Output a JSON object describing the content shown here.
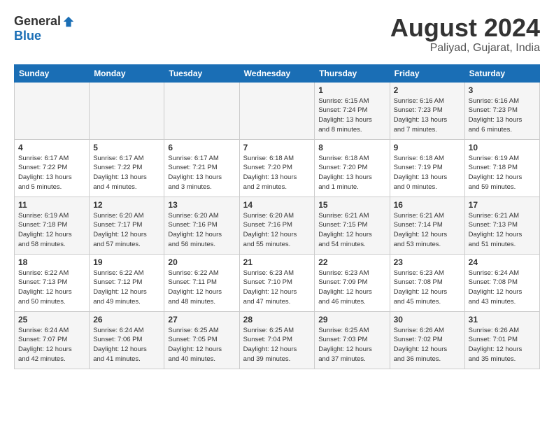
{
  "header": {
    "logo": {
      "general": "General",
      "blue": "Blue"
    },
    "title": "August 2024",
    "location": "Paliyad, Gujarat, India"
  },
  "days_of_week": [
    "Sunday",
    "Monday",
    "Tuesday",
    "Wednesday",
    "Thursday",
    "Friday",
    "Saturday"
  ],
  "weeks": [
    [
      {
        "num": "",
        "info": ""
      },
      {
        "num": "",
        "info": ""
      },
      {
        "num": "",
        "info": ""
      },
      {
        "num": "",
        "info": ""
      },
      {
        "num": "1",
        "info": "Sunrise: 6:15 AM\nSunset: 7:24 PM\nDaylight: 13 hours\nand 8 minutes."
      },
      {
        "num": "2",
        "info": "Sunrise: 6:16 AM\nSunset: 7:23 PM\nDaylight: 13 hours\nand 7 minutes."
      },
      {
        "num": "3",
        "info": "Sunrise: 6:16 AM\nSunset: 7:23 PM\nDaylight: 13 hours\nand 6 minutes."
      }
    ],
    [
      {
        "num": "4",
        "info": "Sunrise: 6:17 AM\nSunset: 7:22 PM\nDaylight: 13 hours\nand 5 minutes."
      },
      {
        "num": "5",
        "info": "Sunrise: 6:17 AM\nSunset: 7:22 PM\nDaylight: 13 hours\nand 4 minutes."
      },
      {
        "num": "6",
        "info": "Sunrise: 6:17 AM\nSunset: 7:21 PM\nDaylight: 13 hours\nand 3 minutes."
      },
      {
        "num": "7",
        "info": "Sunrise: 6:18 AM\nSunset: 7:20 PM\nDaylight: 13 hours\nand 2 minutes."
      },
      {
        "num": "8",
        "info": "Sunrise: 6:18 AM\nSunset: 7:20 PM\nDaylight: 13 hours\nand 1 minute."
      },
      {
        "num": "9",
        "info": "Sunrise: 6:18 AM\nSunset: 7:19 PM\nDaylight: 13 hours\nand 0 minutes."
      },
      {
        "num": "10",
        "info": "Sunrise: 6:19 AM\nSunset: 7:18 PM\nDaylight: 12 hours\nand 59 minutes."
      }
    ],
    [
      {
        "num": "11",
        "info": "Sunrise: 6:19 AM\nSunset: 7:18 PM\nDaylight: 12 hours\nand 58 minutes."
      },
      {
        "num": "12",
        "info": "Sunrise: 6:20 AM\nSunset: 7:17 PM\nDaylight: 12 hours\nand 57 minutes."
      },
      {
        "num": "13",
        "info": "Sunrise: 6:20 AM\nSunset: 7:16 PM\nDaylight: 12 hours\nand 56 minutes."
      },
      {
        "num": "14",
        "info": "Sunrise: 6:20 AM\nSunset: 7:16 PM\nDaylight: 12 hours\nand 55 minutes."
      },
      {
        "num": "15",
        "info": "Sunrise: 6:21 AM\nSunset: 7:15 PM\nDaylight: 12 hours\nand 54 minutes."
      },
      {
        "num": "16",
        "info": "Sunrise: 6:21 AM\nSunset: 7:14 PM\nDaylight: 12 hours\nand 53 minutes."
      },
      {
        "num": "17",
        "info": "Sunrise: 6:21 AM\nSunset: 7:13 PM\nDaylight: 12 hours\nand 51 minutes."
      }
    ],
    [
      {
        "num": "18",
        "info": "Sunrise: 6:22 AM\nSunset: 7:13 PM\nDaylight: 12 hours\nand 50 minutes."
      },
      {
        "num": "19",
        "info": "Sunrise: 6:22 AM\nSunset: 7:12 PM\nDaylight: 12 hours\nand 49 minutes."
      },
      {
        "num": "20",
        "info": "Sunrise: 6:22 AM\nSunset: 7:11 PM\nDaylight: 12 hours\nand 48 minutes."
      },
      {
        "num": "21",
        "info": "Sunrise: 6:23 AM\nSunset: 7:10 PM\nDaylight: 12 hours\nand 47 minutes."
      },
      {
        "num": "22",
        "info": "Sunrise: 6:23 AM\nSunset: 7:09 PM\nDaylight: 12 hours\nand 46 minutes."
      },
      {
        "num": "23",
        "info": "Sunrise: 6:23 AM\nSunset: 7:08 PM\nDaylight: 12 hours\nand 45 minutes."
      },
      {
        "num": "24",
        "info": "Sunrise: 6:24 AM\nSunset: 7:08 PM\nDaylight: 12 hours\nand 43 minutes."
      }
    ],
    [
      {
        "num": "25",
        "info": "Sunrise: 6:24 AM\nSunset: 7:07 PM\nDaylight: 12 hours\nand 42 minutes."
      },
      {
        "num": "26",
        "info": "Sunrise: 6:24 AM\nSunset: 7:06 PM\nDaylight: 12 hours\nand 41 minutes."
      },
      {
        "num": "27",
        "info": "Sunrise: 6:25 AM\nSunset: 7:05 PM\nDaylight: 12 hours\nand 40 minutes."
      },
      {
        "num": "28",
        "info": "Sunrise: 6:25 AM\nSunset: 7:04 PM\nDaylight: 12 hours\nand 39 minutes."
      },
      {
        "num": "29",
        "info": "Sunrise: 6:25 AM\nSunset: 7:03 PM\nDaylight: 12 hours\nand 37 minutes."
      },
      {
        "num": "30",
        "info": "Sunrise: 6:26 AM\nSunset: 7:02 PM\nDaylight: 12 hours\nand 36 minutes."
      },
      {
        "num": "31",
        "info": "Sunrise: 6:26 AM\nSunset: 7:01 PM\nDaylight: 12 hours\nand 35 minutes."
      }
    ]
  ]
}
